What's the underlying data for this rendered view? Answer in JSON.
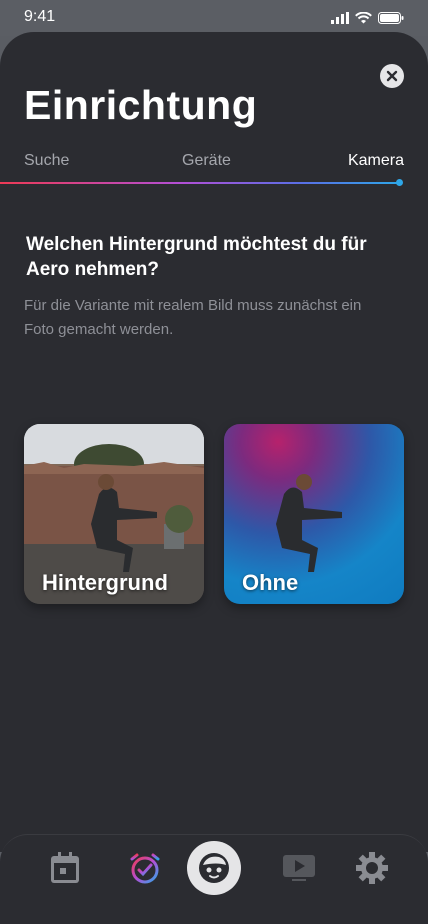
{
  "status": {
    "time": "9:41"
  },
  "header": {
    "title": "Einrichtung"
  },
  "steps": [
    {
      "label": "Suche"
    },
    {
      "label": "Geräte"
    },
    {
      "label": "Kamera"
    }
  ],
  "content": {
    "question": "Welchen Hintergrund möchtest du für Aero nehmen?",
    "hint": "Für die Variante mit realem Bild muss zunächst ein Foto gemacht werden."
  },
  "options": [
    {
      "label": "Hintergrund"
    },
    {
      "label": "Ohne"
    }
  ],
  "nav": [
    {
      "icon": "calendar-icon"
    },
    {
      "icon": "alarm-check-icon"
    },
    {
      "icon": "face-icon"
    },
    {
      "icon": "video-icon"
    },
    {
      "icon": "gear-icon"
    }
  ],
  "colors": {
    "background": "#2b2c31",
    "accent_start": "#ee3a55",
    "accent_end": "#2ea7e8"
  }
}
